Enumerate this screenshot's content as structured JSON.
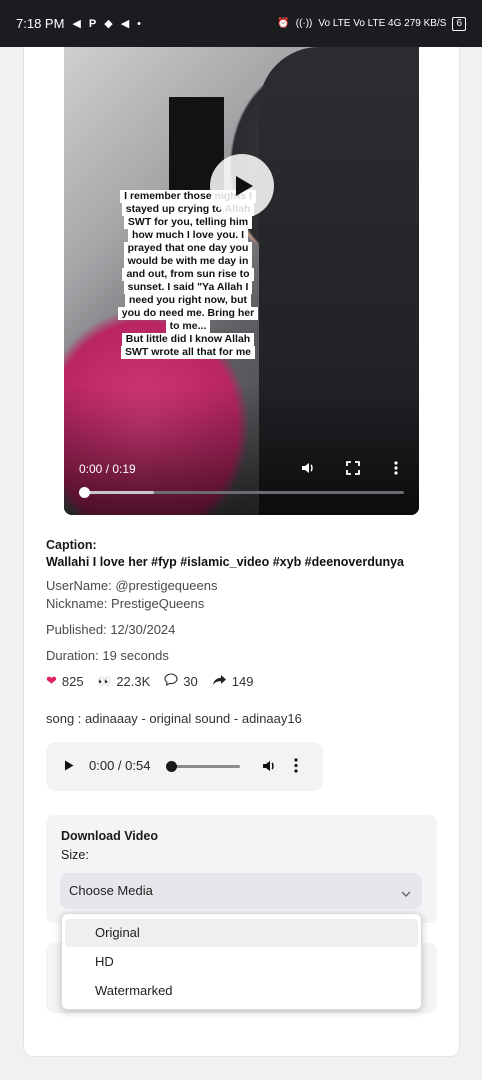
{
  "status_bar": {
    "time": "7:18 PM",
    "right_text": "Vo LTE Vo LTE 4G 279 KB/S",
    "battery": "6",
    "icons": [
      "telegram-icon",
      "p-icon",
      "send-icon",
      "dot-icon",
      "alarm-icon",
      "hotspot-icon",
      "signal-icon",
      "wifi-icon",
      "battery-icon"
    ]
  },
  "video": {
    "overlay_lines": [
      "I remember those nights I",
      "stayed up crying to Allah",
      "SWT for you, telling him",
      "how much I love you. I",
      "prayed that one day you",
      "would be with me day in",
      "and out, from sun rise to",
      "sunset. I said \"Ya Allah I",
      "need you right now, but",
      "you do need me. Bring her",
      "to me...",
      "But little did I know Allah",
      "SWT wrote all that for me"
    ],
    "time": "0:00 / 0:19",
    "progress": 0,
    "buffered": 0.22
  },
  "details": {
    "caption_heading": "Caption:",
    "caption_text": "Wallahi I love her #fyp #islamic_video #xyb #deenoverdunya",
    "username": "UserName: @prestigequeens",
    "nickname": "Nickname: PrestigeQueens",
    "published": "Published: 12/30/2024",
    "duration": "Duration: 19 seconds",
    "stats": {
      "likes": "825",
      "views": "22.3K",
      "comments": "30",
      "shares": "149"
    },
    "song": "song : adinaaay - original sound - adinaay16"
  },
  "audio": {
    "time": "0:00 / 0:54",
    "progress": 0
  },
  "download": {
    "title": "Download Video",
    "size_label": "Size:",
    "select_value": "Choose Media",
    "options": [
      "Original",
      "HD",
      "Watermarked"
    ]
  },
  "colors": {
    "accent_heart": "#e0245e",
    "statusbar_bg": "#1a1c20"
  }
}
